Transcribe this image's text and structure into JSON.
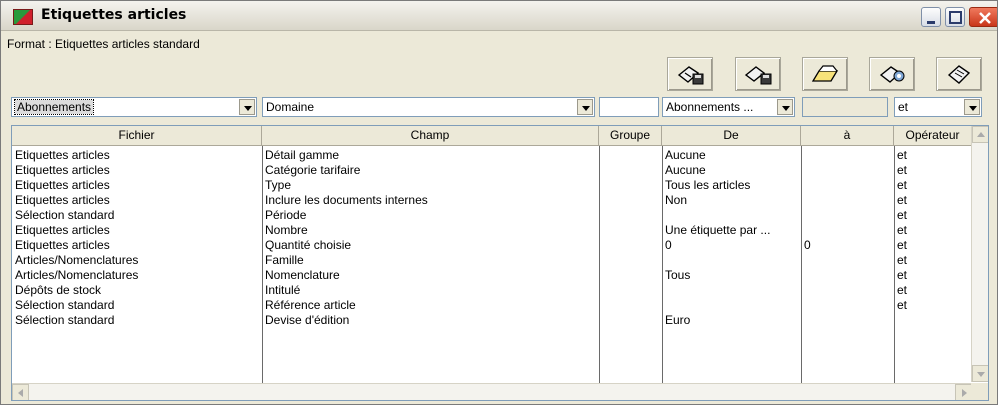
{
  "window": {
    "title": "Etiquettes articles"
  },
  "format": {
    "label": "Format : Etiquettes articles standard"
  },
  "toolbar": {
    "buttons": [
      {
        "icon": "save-format-icon"
      },
      {
        "icon": "save-as-icon"
      },
      {
        "icon": "open-folder-icon"
      },
      {
        "icon": "print-options-icon"
      },
      {
        "icon": "print-icon"
      }
    ]
  },
  "filters": {
    "file_select": "Abonnements",
    "field_select": "Domaine",
    "group_value": "",
    "from_select": "Abonnements ...",
    "to_value": "",
    "operator_select": "et"
  },
  "grid": {
    "columns": [
      "Fichier",
      "Champ",
      "Groupe",
      "De",
      "à",
      "Opérateur"
    ],
    "rows": [
      [
        "Etiquettes articles",
        "Détail gamme",
        "",
        "Aucune",
        "",
        "et"
      ],
      [
        "Etiquettes articles",
        "Catégorie tarifaire",
        "",
        "Aucune",
        "",
        "et"
      ],
      [
        "Etiquettes articles",
        "Type",
        "",
        "Tous les articles",
        "",
        "et"
      ],
      [
        "Etiquettes articles",
        "Inclure les documents internes",
        "",
        "Non",
        "",
        "et"
      ],
      [
        "Sélection standard",
        "Période",
        "",
        "",
        "",
        "et"
      ],
      [
        "Etiquettes articles",
        "Nombre",
        "",
        "Une étiquette par ...",
        "",
        "et"
      ],
      [
        "Etiquettes articles",
        "Quantité choisie",
        "",
        "0",
        "0",
        "et"
      ],
      [
        "Articles/Nomenclatures",
        "Famille",
        "",
        "",
        "",
        "et"
      ],
      [
        "Articles/Nomenclatures",
        "Nomenclature",
        "",
        "Tous",
        "",
        "et"
      ],
      [
        "Dépôts de stock",
        "Intitulé",
        "",
        "",
        "",
        "et"
      ],
      [
        "Sélection standard",
        "Référence article",
        "",
        "",
        "",
        "et"
      ],
      [
        "Sélection standard",
        "Devise d'édition",
        "",
        "Euro",
        "",
        ""
      ]
    ]
  }
}
